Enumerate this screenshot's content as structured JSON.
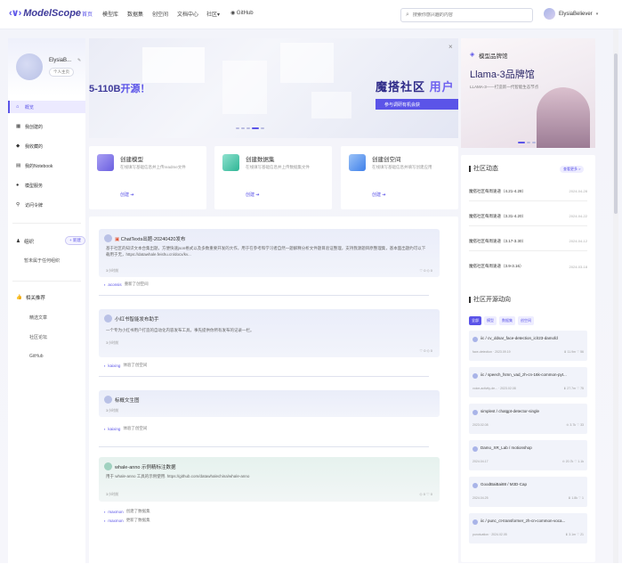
{
  "nav": {
    "logo": "ModelScope",
    "items": [
      {
        "label": "首页",
        "active": true
      },
      {
        "label": "模型库"
      },
      {
        "label": "数据集"
      },
      {
        "label": "创空间"
      },
      {
        "label": "文档中心"
      },
      {
        "label": "社区"
      },
      {
        "label": "GitHub"
      }
    ],
    "community_chevron": "▾",
    "search_placeholder": "搜索你感兴趣的内容",
    "user_name": "ElysiaBeliever"
  },
  "sidebar": {
    "name": "ElysiaB...",
    "badge": "个人主页",
    "items": [
      {
        "label": "概览",
        "icon": "home-icon",
        "active": true
      },
      {
        "label": "我创建的",
        "icon": "grid-icon"
      },
      {
        "label": "我收藏的",
        "icon": "tag-icon"
      },
      {
        "label": "我的Notebook",
        "icon": "notebook-icon"
      },
      {
        "label": "模型服务",
        "icon": "service-icon"
      },
      {
        "label": "访问令牌",
        "icon": "key-icon"
      }
    ],
    "org_title": "组织",
    "org_add": "+ 新建",
    "org_text": "暂未属于任何组织",
    "rec_title": "相关推荐",
    "rec_items": [
      "精选文章",
      "社区论坛",
      "GitHub"
    ]
  },
  "banner": {
    "left_text_a": "5-110B",
    "left_text_b": "开源！",
    "right_text_a": "魔搭社区",
    "right_text_b": "用户",
    "sub_text": "参与调研有机会获",
    "close": "×"
  },
  "create_cards": [
    {
      "title": "创建模型",
      "desc": "在线填写基础信息并上传readme文件",
      "link": "创建 ➔",
      "color": "#7a6fe8"
    },
    {
      "title": "创建数据集",
      "desc": "在线填写基础信息并上传数据集文件",
      "link": "创建 ➔",
      "color": "#3fc3a7"
    },
    {
      "title": "创建创空间",
      "desc": "在线填写基础信息并填写创建应用",
      "link": "创建 ➔",
      "color": "#4a8ef0"
    }
  ],
  "feed": [
    {
      "title": "ChatTexts出题-20240420发布",
      "desc": "基于社区的知识文本合集出题，方便快速json格式以及多数重要开发的大作，用于在参考和学习者自然一题解释分析文件题目验证整理，支持我源题目原整理集，基本面出题约可以下载用于无，https://datawhale.feishu.cn/docx/kv...",
      "meta": "3小时前",
      "stats": "♡ 0   ◇ 0",
      "act_user": "aconsis",
      "act_text": "重新了创空间"
    },
    {
      "title": "小红书智能发布助手",
      "desc": "一个专为小红书用户打造的自动化内容发布工具，事先提供你所有发布的记录一栏。",
      "meta": "3小时前",
      "stats": "♡ 0   ◇ 0",
      "act_user": "kaixing",
      "act_text": "体验了创空间"
    },
    {
      "title": "标概文生图",
      "desc": "",
      "meta": "3小时前",
      "stats": "",
      "act_user": "kaixing",
      "act_text": "体验了创空间"
    },
    {
      "title": "whale-anno 示例精标注数据",
      "desc": "用于 whale-anno 工具的示例使用. https://github.com/datawhalechina/whale-anno",
      "meta": "3小时前",
      "stats": "◇ 0   ♡ 0",
      "act_user": "maxmon",
      "act_text": "创建了数据集",
      "act2_user": "maxmon",
      "act2_text": "更新了数据集"
    }
  ],
  "brand": {
    "title": "模型品牌馆",
    "main": "Llama-3品牌馆",
    "sub": "LLAMA-3——打造新一代智能生态节点"
  },
  "news": {
    "title": "社区动态",
    "more": "查看更多 >",
    "items": [
      {
        "t": "魔搭社区每周速递（4.21-4.28）",
        "d": "2024-04-28"
      },
      {
        "t": "魔搭社区每周速递（3.31-4.20）",
        "d": "2024-04-22"
      },
      {
        "t": "魔搭社区每周速递（3.17-3.30）",
        "d": "2024-04-12"
      },
      {
        "t": "魔搭社区每周速递（3.9-3.16）",
        "d": "2024-03-18"
      }
    ]
  },
  "opensource": {
    "title": "社区开源动向",
    "filters": [
      "全部",
      "模型",
      "数据集",
      "创空间"
    ],
    "repos": [
      {
        "name": "iic / cv_ddsar_face-detection_iclr23-damofd",
        "meta": "face-detection · 2023.09.19",
        "stats": "⬇ 11.9m  ♡ 56"
      },
      {
        "name": "iic / speech_fsmn_vad_zh-cn-16k-common-pyt...",
        "meta": "voice-activity-de... · 2023.02.08",
        "stats": "⬇ 27.7m  ♡ 75"
      },
      {
        "name": "simplest / chatgpt-detector-single",
        "meta": "2023.02.08",
        "stats": "⊙ 3.7k  ♡ 33"
      },
      {
        "name": "Damo_XR_Lab / motionshop",
        "meta": "2024.04.17",
        "stats": "⊙ 20.7k  ♡ 1.1k"
      },
      {
        "name": "GoodBaiBai88 / M3D-Cap",
        "meta": "2024.04.25",
        "stats": "⬇ 1.8k  ♡ 1"
      },
      {
        "name": "iic / punc_ct-transformer_zh-cn-common-voca...",
        "meta": "punctuation · 2024.02.05",
        "stats": "⬇ 3.1m  ♡ 21"
      }
    ]
  }
}
